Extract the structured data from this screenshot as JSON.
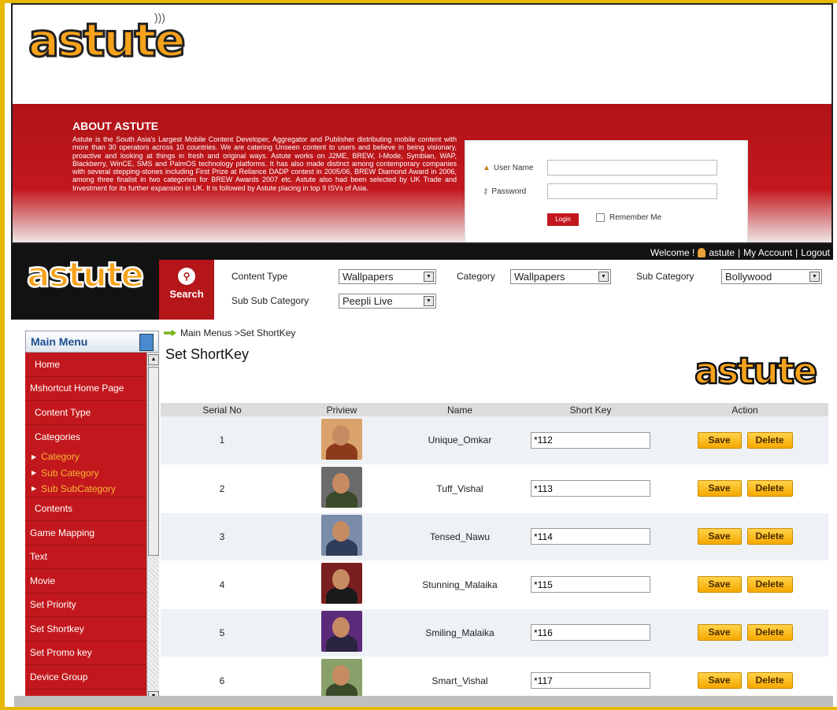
{
  "login_page": {
    "logo": "astute",
    "about_title": "ABOUT ASTUTE",
    "about_text": "Astute is the South Asia's Largest Mobile Content Developer, Aggregator and Publisher distributing mobile content with more than 30 operators across 10 countries. We are catering Unseen content to users and believe in being visionary, proactive and looking at things in fresh and original ways. Astute works on J2ME, BREW, I-Mode, Symbian, WAP, Blackberry, WinCE, SMS and PalmOS technology platforms. It has also made distinct among contemporary companies with several stepping-stones including First Prize at Reliance DADP contest in 2005/06, BREW Diamond Award in 2006, among three finalist in two categories for BREW Awards 2007 etc. Astute also had been selected by UK Trade and Investment for its further expansion in UK. It is followed by Astute placing in top 9 ISVs of Asia.",
    "username_label": "User Name",
    "password_label": "Password",
    "login_button": "Login",
    "remember_label": "Remember Me"
  },
  "header": {
    "logo": "astute",
    "welcome_text": "Welcome !",
    "user_link": "astute",
    "sep1": "|",
    "account_link": "My Account",
    "sep2": "|",
    "logout_link": "Logout",
    "search_label": "Search"
  },
  "filters": {
    "content_type_label": "Content Type",
    "content_type_value": "Wallpapers",
    "category_label": "Category",
    "category_value": "Wallpapers",
    "sub_category_label": "Sub Category",
    "sub_category_value": "Bollywood",
    "sub_sub_category_label": "Sub Sub Category",
    "sub_sub_category_value": "Peepli Live"
  },
  "sidebar": {
    "title": "Main Menu",
    "items": [
      {
        "label": "Home"
      },
      {
        "label": "Mshortcut Home Page"
      },
      {
        "label": "Content Type"
      },
      {
        "label": "Categories"
      }
    ],
    "sub_items": [
      {
        "label": "Category"
      },
      {
        "label": "Sub Category"
      },
      {
        "label": "Sub SubCategory"
      }
    ],
    "items2": [
      {
        "label": "Contents"
      },
      {
        "label": "Game Mapping"
      },
      {
        "label": "Text"
      },
      {
        "label": "Movie"
      },
      {
        "label": "Set Priority"
      },
      {
        "label": "Set Shortkey"
      },
      {
        "label": "Set Promo key"
      },
      {
        "label": "Device Group"
      }
    ]
  },
  "content": {
    "breadcrumb": "Main Menus >Set ShortKey",
    "page_title": "Set ShortKey",
    "logo": "astute",
    "columns": [
      "Serial No",
      "Priview",
      "Name",
      "Short Key",
      "Action"
    ],
    "save_label": "Save",
    "delete_label": "Delete",
    "rows": [
      {
        "serial": "1",
        "name": "Unique_Omkar",
        "short_key": "*112"
      },
      {
        "serial": "2",
        "name": "Tuff_Vishal",
        "short_key": "*113"
      },
      {
        "serial": "3",
        "name": "Tensed_Nawu",
        "short_key": "*114"
      },
      {
        "serial": "4",
        "name": "Stunning_Malaika",
        "short_key": "*115"
      },
      {
        "serial": "5",
        "name": "Smiling_Malaika",
        "short_key": "*116"
      },
      {
        "serial": "6",
        "name": "Smart_Vishal",
        "short_key": "*117"
      }
    ]
  }
}
